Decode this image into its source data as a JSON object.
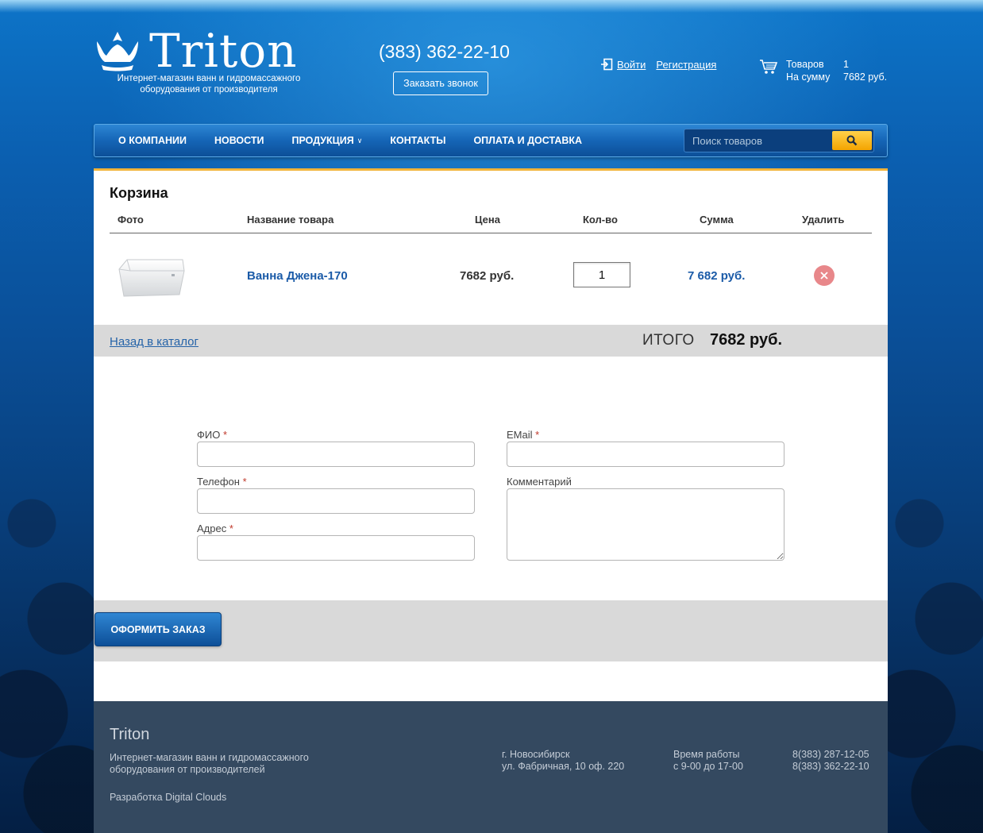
{
  "header": {
    "brand": "Triton",
    "tagline": "Интернет-магазин ванн и гидромассажного оборудования от производителя",
    "phone": "(383) 362-22-10",
    "callback_label": "Заказать звонок",
    "login_label": "Войти",
    "register_label": "Регистрация",
    "cart": {
      "items_label": "Товаров",
      "items_count": "1",
      "sum_label": "На сумму",
      "sum_value": "7682 руб."
    }
  },
  "nav": {
    "items": [
      {
        "label": "О компании"
      },
      {
        "label": "Новости"
      },
      {
        "label": "Продукция"
      },
      {
        "label": "Контакты"
      },
      {
        "label": "Оплата и доставка"
      }
    ],
    "dropdown_marker": "∨",
    "search_placeholder": "Поиск товаров"
  },
  "cart_page": {
    "title": "Корзина",
    "columns": [
      "Фото",
      "Название товара",
      "Цена",
      "Кол-во",
      "Сумма",
      "Удалить"
    ],
    "rows": [
      {
        "name": "Ванна Джена-170",
        "price": "7682 руб.",
        "qty": "1",
        "sum": "7 682 руб."
      }
    ],
    "back_link": "Назад в каталог",
    "total_label": "ИТОГО",
    "total_value": "7682 руб."
  },
  "form": {
    "fio_label": "ФИО",
    "phone_label": "Телефон",
    "address_label": "Адрес",
    "email_label": "EMail",
    "comment_label": "Комментарий",
    "required_mark": "*",
    "submit_label": "ОФОРМИТЬ ЗАКАЗ"
  },
  "footer": {
    "brand": "Triton",
    "description": "Интернет-магазин ванн и гидромассажного оборудования от производителей",
    "developer": "Разработка Digital Clouds",
    "city": "г. Новосибирск",
    "address": "ул. Фабричная, 10 оф. 220",
    "hours_label": "Время работы",
    "hours": "с 9-00 до 17-00",
    "phone1": "8(383) 287-12-05",
    "phone2": "8(383) 362-22-10"
  },
  "colors": {
    "accent": "#1b5ba8",
    "nav": "#1565b6",
    "search_button": "#f4a400",
    "delete": "#e8878a",
    "footer": "#344960"
  },
  "icons": [
    "crown-logo-icon",
    "login-icon",
    "cart-icon",
    "search-icon",
    "delete-icon"
  ]
}
